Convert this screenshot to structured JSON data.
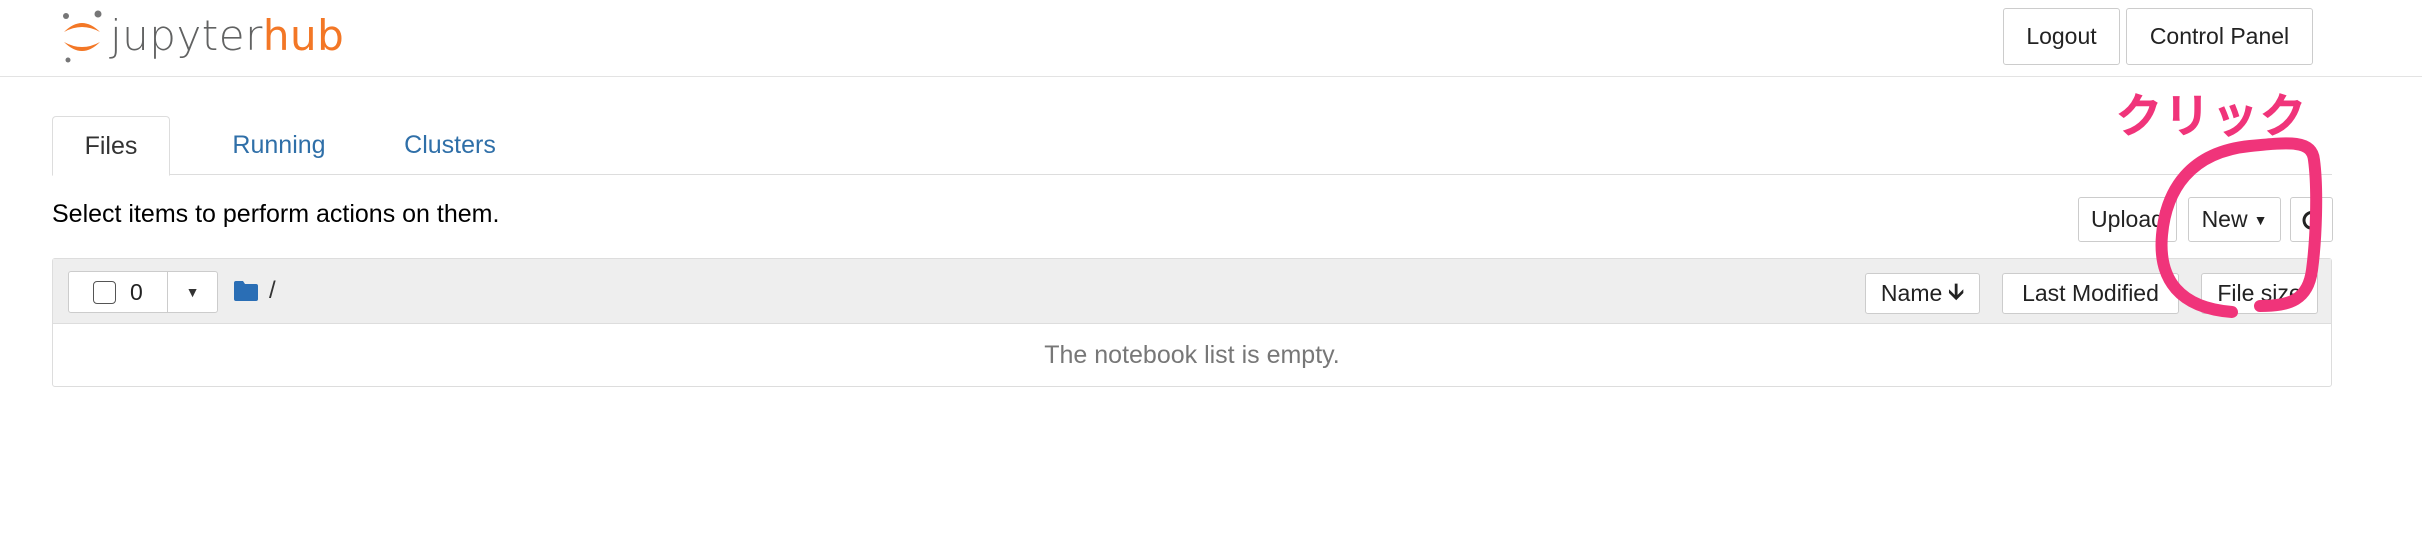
{
  "header": {
    "logo_text_a": "jupyter",
    "logo_text_b": "hub",
    "logout_label": "Logout",
    "control_panel_label": "Control Panel"
  },
  "tabs": [
    {
      "label": "Files",
      "active": true
    },
    {
      "label": "Running",
      "active": false
    },
    {
      "label": "Clusters",
      "active": false
    }
  ],
  "toolbar": {
    "hint": "Select items to perform actions on them.",
    "upload_label": "Upload",
    "new_label": "New",
    "refresh_icon": "refresh-icon"
  },
  "list": {
    "selected_count": "0",
    "breadcrumb_sep": "/",
    "sort_name_label": "Name",
    "sort_modified_label": "Last Modified",
    "sort_size_label": "File size",
    "empty_message": "The notebook list is empty."
  },
  "annotation": {
    "text": "クリック",
    "color": "#f0347a"
  },
  "colors": {
    "brand_orange": "#f37726",
    "link_blue": "#2f6fa8",
    "folder_blue": "#2a6eb5"
  }
}
